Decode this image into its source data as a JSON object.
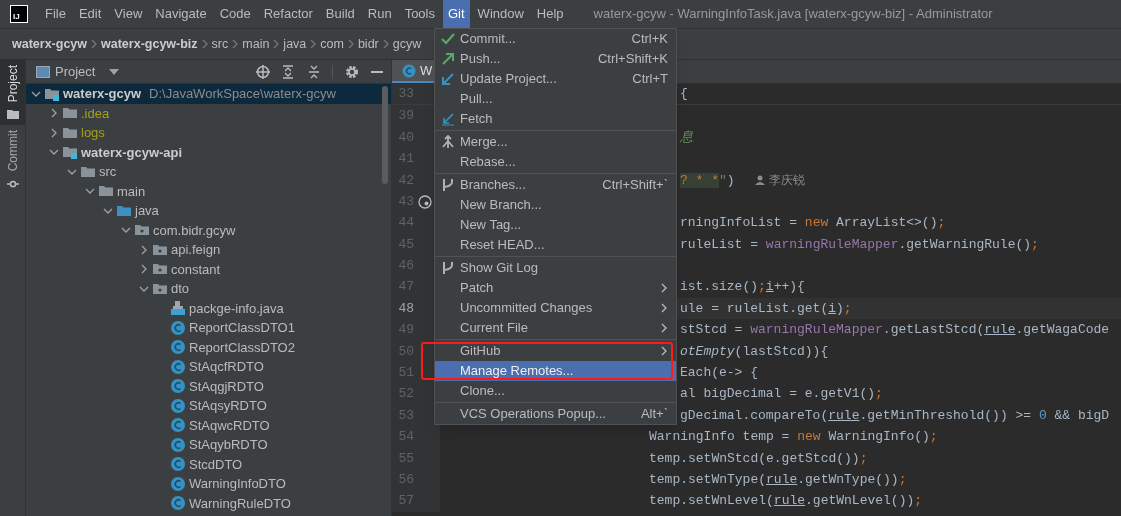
{
  "menu_bar": {
    "logo": "IJ",
    "items": [
      {
        "label": "File",
        "selected": false
      },
      {
        "label": "Edit",
        "selected": false
      },
      {
        "label": "View",
        "selected": false
      },
      {
        "label": "Navigate",
        "selected": false
      },
      {
        "label": "Code",
        "selected": false
      },
      {
        "label": "Refactor",
        "selected": false
      },
      {
        "label": "Build",
        "selected": false
      },
      {
        "label": "Run",
        "selected": false
      },
      {
        "label": "Tools",
        "selected": false
      },
      {
        "label": "Git",
        "selected": true
      },
      {
        "label": "Window",
        "selected": false
      },
      {
        "label": "Help",
        "selected": false
      }
    ],
    "title": "waterx-gcyw - WarningInfoTask.java [waterx-gcyw-biz] - Administrator"
  },
  "breadcrumbs": [
    {
      "label": "waterx-gcyw",
      "kind": "module"
    },
    {
      "label": "waterx-gcyw-biz",
      "kind": "module"
    },
    {
      "label": "src",
      "kind": "folder"
    },
    {
      "label": "main",
      "kind": "folder"
    },
    {
      "label": "java",
      "kind": "folder"
    },
    {
      "label": "com",
      "kind": "folder"
    },
    {
      "label": "bidr",
      "kind": "folder"
    },
    {
      "label": "gcyw",
      "kind": "folder"
    }
  ],
  "tool_stripe": [
    {
      "label": "Project",
      "kind": "project",
      "selected": true
    },
    {
      "label": "Commit",
      "kind": "commit",
      "selected": false
    }
  ],
  "project_panel": {
    "title": "Project",
    "tree": [
      {
        "label": "waterx-gcyw",
        "kind": "module",
        "path": "D:\\JavaWorkSpace\\waterx-gcyw",
        "expanded": true,
        "selected": true,
        "children": [
          {
            "label": ".idea",
            "kind": "ignored",
            "expanded": false,
            "selected": false
          },
          {
            "label": "logs",
            "kind": "ignored",
            "expanded": false,
            "selected": false
          },
          {
            "label": "waterx-gcyw-api",
            "kind": "module",
            "expanded": true,
            "selected": false,
            "children": [
              {
                "label": "src",
                "kind": "folder",
                "expanded": true,
                "selected": false,
                "children": [
                  {
                    "label": "main",
                    "kind": "folder",
                    "expanded": true,
                    "selected": false,
                    "children": [
                      {
                        "label": "java",
                        "kind": "source",
                        "expanded": true,
                        "selected": false,
                        "children": [
                          {
                            "label": "com.bidr.gcyw",
                            "kind": "package",
                            "expanded": true,
                            "selected": false,
                            "children": [
                              {
                                "label": "api.feign",
                                "kind": "package",
                                "expanded": false,
                                "selected": false
                              },
                              {
                                "label": "constant",
                                "kind": "package",
                                "expanded": false,
                                "selected": false
                              },
                              {
                                "label": "dto",
                                "kind": "package",
                                "expanded": true,
                                "selected": false,
                                "children": [
                                  {
                                    "label": "packge-info.java",
                                    "kind": "file",
                                    "selected": false
                                  },
                                  {
                                    "label": "ReportClassDTO1",
                                    "kind": "class",
                                    "selected": false
                                  },
                                  {
                                    "label": "ReportClassDTO2",
                                    "kind": "class",
                                    "selected": false
                                  },
                                  {
                                    "label": "StAqcfRDTO",
                                    "kind": "class",
                                    "selected": false
                                  },
                                  {
                                    "label": "StAqgjRDTO",
                                    "kind": "class",
                                    "selected": false
                                  },
                                  {
                                    "label": "StAqsyRDTO",
                                    "kind": "class",
                                    "selected": false
                                  },
                                  {
                                    "label": "StAqwcRDTO",
                                    "kind": "class",
                                    "selected": false
                                  },
                                  {
                                    "label": "StAqybRDTO",
                                    "kind": "class",
                                    "selected": false
                                  },
                                  {
                                    "label": "StcdDTO",
                                    "kind": "class",
                                    "selected": false
                                  },
                                  {
                                    "label": "WarningInfoDTO",
                                    "kind": "class",
                                    "selected": false
                                  },
                                  {
                                    "label": "WarningRuleDTO",
                                    "kind": "class",
                                    "selected": false
                                  }
                                ]
                              }
                            ]
                          }
                        ]
                      }
                    ]
                  }
                ]
              }
            ]
          }
        ]
      }
    ]
  },
  "editor": {
    "tabs": [
      {
        "label": "W",
        "selected": true
      }
    ],
    "lines": [
      {
        "number": "33",
        "kind": "partial",
        "current": false,
        "tokens": [
          {
            "text": "{",
            "kind": "plain"
          }
        ]
      },
      {
        "number": "39",
        "kind": "blank",
        "current": false
      },
      {
        "number": "40",
        "kind": "partial",
        "current": false,
        "tokens": [
          {
            "text": "息",
            "kind": "comment"
          }
        ]
      },
      {
        "number": "41",
        "kind": "blank",
        "current": false
      },
      {
        "number": "42",
        "kind": "partial",
        "current": false,
        "tokens": [
          {
            "text": "? * *",
            "kind": "injected"
          },
          {
            "text": "\"",
            "kind": "string"
          },
          {
            "text": ")",
            "kind": "plain"
          }
        ],
        "author": "李庆锐"
      },
      {
        "number": "43",
        "kind": "blank",
        "current": false,
        "gutter_marker": true
      },
      {
        "number": "44",
        "kind": "partial",
        "current": false,
        "tokens": [
          {
            "text": "rningInfoList = ",
            "kind": "plain"
          },
          {
            "text": "new",
            "kind": "keyword"
          },
          {
            "text": " ArrayList<>()",
            "kind": "plain"
          },
          {
            "text": ";",
            "kind": "keyword"
          }
        ]
      },
      {
        "number": "45",
        "kind": "partial",
        "current": false,
        "tokens": [
          {
            "text": "ruleList = ",
            "kind": "plain"
          },
          {
            "text": "warningRuleMapper",
            "kind": "field"
          },
          {
            "text": ".getWarningRule()",
            "kind": "plain"
          },
          {
            "text": ";",
            "kind": "keyword"
          }
        ]
      },
      {
        "number": "46",
        "kind": "blank",
        "current": false
      },
      {
        "number": "47",
        "kind": "partial",
        "current": false,
        "tokens": [
          {
            "text": "ist.size()",
            "kind": "plain"
          },
          {
            "text": ";",
            "kind": "keyword"
          },
          {
            "text": "i",
            "kind": "underlined"
          },
          {
            "text": "++){",
            "kind": "plain"
          }
        ]
      },
      {
        "number": "48",
        "kind": "partial",
        "current": true,
        "tokens": [
          {
            "text": "ule = ruleList.get(",
            "kind": "plain"
          },
          {
            "text": "i",
            "kind": "underlined"
          },
          {
            "text": ")",
            "kind": "plain"
          },
          {
            "text": ";",
            "kind": "keyword"
          }
        ]
      },
      {
        "number": "49",
        "kind": "partial",
        "current": false,
        "tokens": [
          {
            "text": "stStcd = ",
            "kind": "plain"
          },
          {
            "text": "warningRuleMapper",
            "kind": "field"
          },
          {
            "text": ".getLastStcd(",
            "kind": "plain"
          },
          {
            "text": "rule",
            "kind": "underlined"
          },
          {
            "text": ".getWagaCode",
            "kind": "plain"
          }
        ]
      },
      {
        "number": "50",
        "kind": "partial",
        "current": false,
        "tokens": [
          {
            "text": "otEmpty",
            "kind": "italic"
          },
          {
            "text": "(lastStcd)){",
            "kind": "plain"
          }
        ]
      },
      {
        "number": "51",
        "kind": "partial",
        "current": false,
        "tokens": [
          {
            "text": "Each(e-> {",
            "kind": "plain"
          }
        ]
      },
      {
        "number": "52",
        "kind": "partial",
        "current": false,
        "tokens": [
          {
            "text": "al bigDecimal = e.getV1()",
            "kind": "plain"
          },
          {
            "text": ";",
            "kind": "keyword"
          }
        ]
      },
      {
        "number": "53",
        "kind": "partial",
        "current": false,
        "tokens": [
          {
            "text": "gDecimal.compareTo(",
            "kind": "plain"
          },
          {
            "text": "rule",
            "kind": "underlined"
          },
          {
            "text": ".getMinThreshold()) >= ",
            "kind": "plain"
          },
          {
            "text": "0",
            "kind": "number"
          },
          {
            "text": " && bigD",
            "kind": "plain"
          }
        ]
      },
      {
        "number": "54",
        "kind": "full",
        "current": false,
        "tokens": [
          {
            "text": "WarningInfo temp = ",
            "kind": "plain"
          },
          {
            "text": "new",
            "kind": "keyword"
          },
          {
            "text": " WarningInfo()",
            "kind": "plain"
          },
          {
            "text": ";",
            "kind": "keyword"
          }
        ]
      },
      {
        "number": "55",
        "kind": "full",
        "current": false,
        "tokens": [
          {
            "text": "temp.setWnStcd(e.getStcd())",
            "kind": "plain"
          },
          {
            "text": ";",
            "kind": "keyword"
          }
        ]
      },
      {
        "number": "56",
        "kind": "full",
        "current": false,
        "tokens": [
          {
            "text": "temp.setWnType(",
            "kind": "plain"
          },
          {
            "text": "rule",
            "kind": "underlined"
          },
          {
            "text": ".getWnType())",
            "kind": "plain"
          },
          {
            "text": ";",
            "kind": "keyword"
          }
        ]
      },
      {
        "number": "57",
        "kind": "full",
        "current": false,
        "tokens": [
          {
            "text": "temp.setWnLevel(",
            "kind": "plain"
          },
          {
            "text": "rule",
            "kind": "underlined"
          },
          {
            "text": ".getWnLevel())",
            "kind": "plain"
          },
          {
            "text": ";",
            "kind": "keyword"
          }
        ]
      }
    ]
  },
  "git_menu": {
    "sections": [
      {
        "items": [
          {
            "label": "Commit...",
            "shortcut": "Ctrl+K",
            "kind": "commit",
            "submenu": false,
            "selected": false
          },
          {
            "label": "Push...",
            "shortcut": "Ctrl+Shift+K",
            "kind": "push",
            "submenu": false,
            "selected": false
          },
          {
            "label": "Update Project...",
            "shortcut": "Ctrl+T",
            "kind": "update",
            "submenu": false,
            "selected": false
          },
          {
            "label": "Pull...",
            "kind": "plain",
            "submenu": false,
            "selected": false
          },
          {
            "label": "Fetch",
            "kind": "fetch",
            "submenu": false,
            "selected": false
          }
        ]
      },
      {
        "items": [
          {
            "label": "Merge...",
            "kind": "merge",
            "submenu": false,
            "selected": false
          },
          {
            "label": "Rebase...",
            "kind": "plain",
            "submenu": false,
            "selected": false
          }
        ]
      },
      {
        "items": [
          {
            "label": "Branches...",
            "shortcut": "Ctrl+Shift+`",
            "kind": "branch",
            "submenu": false,
            "selected": false
          },
          {
            "label": "New Branch...",
            "kind": "plain",
            "submenu": false,
            "selected": false
          },
          {
            "label": "New Tag...",
            "kind": "plain",
            "submenu": false,
            "selected": false
          },
          {
            "label": "Reset HEAD...",
            "kind": "plain",
            "submenu": false,
            "selected": false
          }
        ]
      },
      {
        "items": [
          {
            "label": "Show Git Log",
            "kind": "branch",
            "submenu": false,
            "selected": false
          },
          {
            "label": "Patch",
            "submenu": true,
            "selected": false
          },
          {
            "label": "Uncommitted Changes",
            "submenu": true,
            "selected": false
          },
          {
            "label": "Current File",
            "submenu": true,
            "selected": false
          }
        ]
      },
      {
        "items": [
          {
            "label": "GitHub",
            "submenu": true,
            "selected": false
          },
          {
            "label": "Manage Remotes...",
            "submenu": false,
            "selected": true
          },
          {
            "label": "Clone...",
            "submenu": false,
            "selected": false
          }
        ]
      },
      {
        "items": [
          {
            "label": "VCS Operations Popup...",
            "shortcut": "Alt+`",
            "submenu": false,
            "selected": false
          }
        ]
      }
    ]
  },
  "annotations": [
    {
      "kind": "rectangle"
    }
  ]
}
